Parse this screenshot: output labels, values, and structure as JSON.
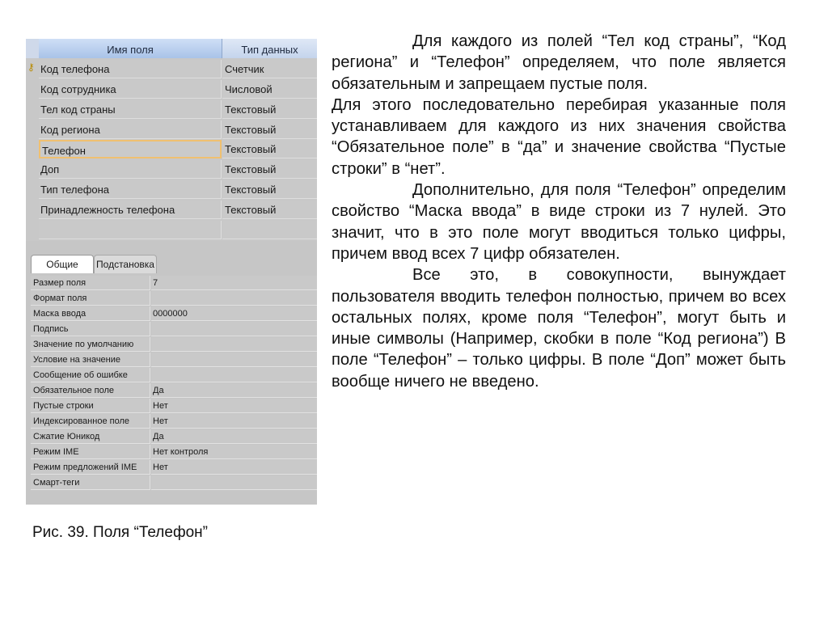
{
  "design_grid": {
    "headers": {
      "field_name": "Имя поля",
      "data_type": "Тип данных"
    },
    "rows": [
      {
        "name": "Код телефона",
        "type": "Счетчик",
        "key": true
      },
      {
        "name": "Код сотрудника",
        "type": "Числовой"
      },
      {
        "name": "Тел код страны",
        "type": "Текстовый"
      },
      {
        "name": "Код региона",
        "type": "Текстовый"
      },
      {
        "name": "Телефон",
        "type": "Текстовый",
        "active": true
      },
      {
        "name": "Доп",
        "type": "Текстовый"
      },
      {
        "name": "Тип телефона",
        "type": "Текстовый"
      },
      {
        "name": "Принадлежность телефона",
        "type": "Текстовый"
      }
    ],
    "key_icon": "key-icon"
  },
  "properties": {
    "tabs": [
      "Общие",
      "Подстановка"
    ],
    "active_tab": "Общие",
    "rows": [
      {
        "name": "Размер поля",
        "value": "7"
      },
      {
        "name": "Формат поля",
        "value": ""
      },
      {
        "name": "Маска ввода",
        "value": "0000000"
      },
      {
        "name": "Подпись",
        "value": ""
      },
      {
        "name": "Значение по умолчанию",
        "value": ""
      },
      {
        "name": "Условие на значение",
        "value": ""
      },
      {
        "name": "Сообщение об ошибке",
        "value": ""
      },
      {
        "name": "Обязательное поле",
        "value": "Да"
      },
      {
        "name": "Пустые строки",
        "value": "Нет"
      },
      {
        "name": "Индексированное поле",
        "value": "Нет"
      },
      {
        "name": "Сжатие Юникод",
        "value": "Да"
      },
      {
        "name": "Режим IME",
        "value": "Нет контроля"
      },
      {
        "name": "Режим предложений IME",
        "value": "Нет"
      },
      {
        "name": "Смарт-теги",
        "value": ""
      }
    ]
  },
  "caption": "Рис. 39. Поля “Телефон”",
  "body": {
    "p1": "Для каждого из полей “Тел код страны”, “Код региона” и “Телефон” определяем, что поле является обязательным и запрещаем пустые поля.",
    "p2": "Для этого последовательно перебирая указанные поля устанавливаем для каждого из них значения свойства “Обязательное поле” в “да” и значение свойства “Пустые строки” в “нет”.",
    "p3": "Дополнительно, для поля “Телефон” определим свойство “Маска ввода” в виде строки из 7 нулей. Это значит, что в это поле могут вводиться только цифры, причем ввод всех 7 цифр обязателен.",
    "p4": "Все это, в совокупности, вынуждает пользователя вводить телефон полностью, причем во всех остальных полях, кроме поля “Телефон”, могут быть и иные символы (Например, скобки в поле “Код региона”) В поле “Телефон” – только цифры. В поле “Доп” может быть вообще ничего не введено."
  }
}
